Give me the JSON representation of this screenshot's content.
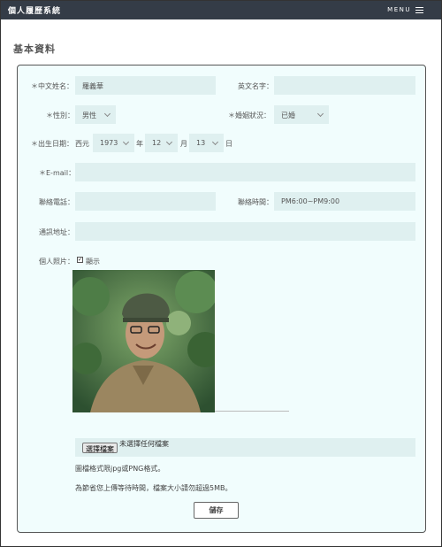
{
  "header": {
    "brand": "個人履歷系統",
    "menu_label": "MENU"
  },
  "page_title": "基本資料",
  "form": {
    "chinese_name_label": "＊中文姓名：",
    "chinese_name_value": "羅義華",
    "english_name_label": "英文名字：",
    "english_name_value": "",
    "gender_label": "＊性別：",
    "gender_value": "男性",
    "marital_label": "＊婚姻狀況：",
    "marital_value": "已婚",
    "birth_label": "＊出生日期：",
    "era_label": "西元",
    "birth_year": "1973",
    "year_unit": "年",
    "birth_month": "12",
    "month_unit": "月",
    "birth_day": "13",
    "day_unit": "日",
    "email_label": "＊E-mail：",
    "email_value": "",
    "phone_label": "聯絡電話：",
    "phone_value": "",
    "contact_time_label": "聯絡時間：",
    "contact_time_value": "PM6:00~PM9:00",
    "address_label": "通訊地址：",
    "address_value": "",
    "photo_label": "個人照片：",
    "show_label": "顯示",
    "show_checked": true,
    "file_button": "選擇檔案",
    "file_status": "未選擇任何檔案",
    "note_format": "圖檔格式限jpg或PNG格式。",
    "note_size": "為節省您上傳等待時間，檔案大小請勿超過5MB。",
    "save_label": "儲存"
  }
}
